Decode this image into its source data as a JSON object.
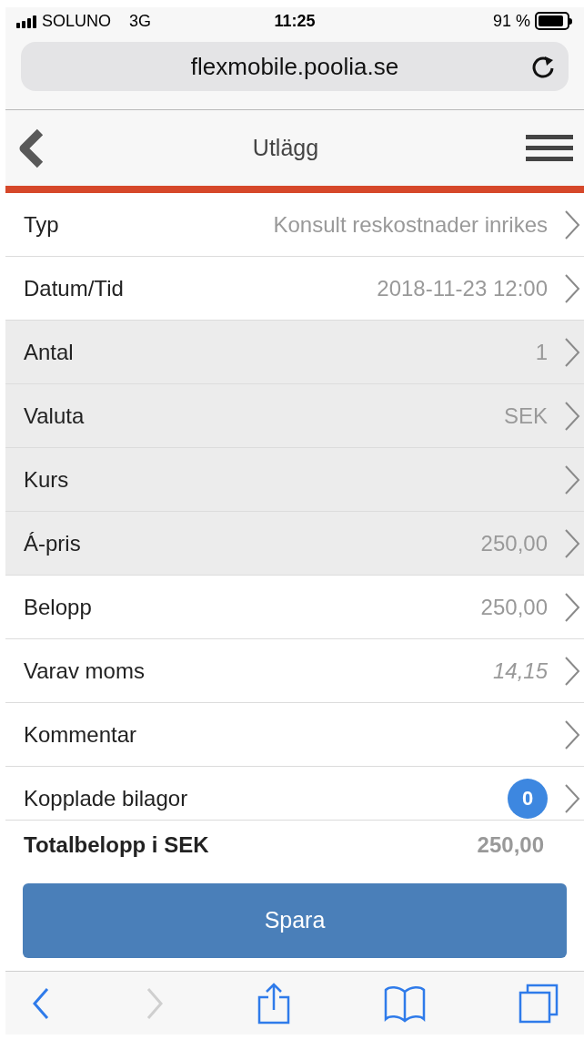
{
  "status_bar": {
    "carrier": "SOLUNO",
    "network": "3G",
    "time": "11:25",
    "battery": "91 %"
  },
  "address_bar": {
    "url": "flexmobile.poolia.se"
  },
  "header": {
    "title": "Utlägg"
  },
  "rows": [
    {
      "label": "Typ",
      "value": "Konsult reskostnader inrikes",
      "readonly": false,
      "kind": "text"
    },
    {
      "label": "Datum/Tid",
      "value": "2018-11-23 12:00",
      "readonly": false,
      "kind": "text"
    },
    {
      "label": "Antal",
      "value": "1",
      "readonly": true,
      "kind": "text"
    },
    {
      "label": "Valuta",
      "value": "SEK",
      "readonly": true,
      "kind": "text"
    },
    {
      "label": "Kurs",
      "readonly": true
    },
    {
      "label": "Á-pris",
      "value": "250,00",
      "readonly": true,
      "kind": "text"
    },
    {
      "label": "Belopp",
      "value": "250,00",
      "readonly": false,
      "kind": "text"
    },
    {
      "label": "Varav moms",
      "value": "14,15",
      "readonly": false,
      "kind": "calculated"
    },
    {
      "label": "Kommentar",
      "readonly": false
    },
    {
      "label": "Kopplade bilagor",
      "value": "0",
      "readonly": false,
      "kind": "count"
    }
  ],
  "total": {
    "label": "Totalbelopp i SEK",
    "value": "250,00"
  },
  "save_button": "Spara",
  "browser_toolbar": [
    {
      "kind": "back",
      "disabled": false
    },
    {
      "kind": "forward",
      "disabled": true
    },
    {
      "kind": "share",
      "disabled": false
    },
    {
      "kind": "bookmarks",
      "disabled": false
    },
    {
      "kind": "tabs",
      "disabled": false
    }
  ]
}
